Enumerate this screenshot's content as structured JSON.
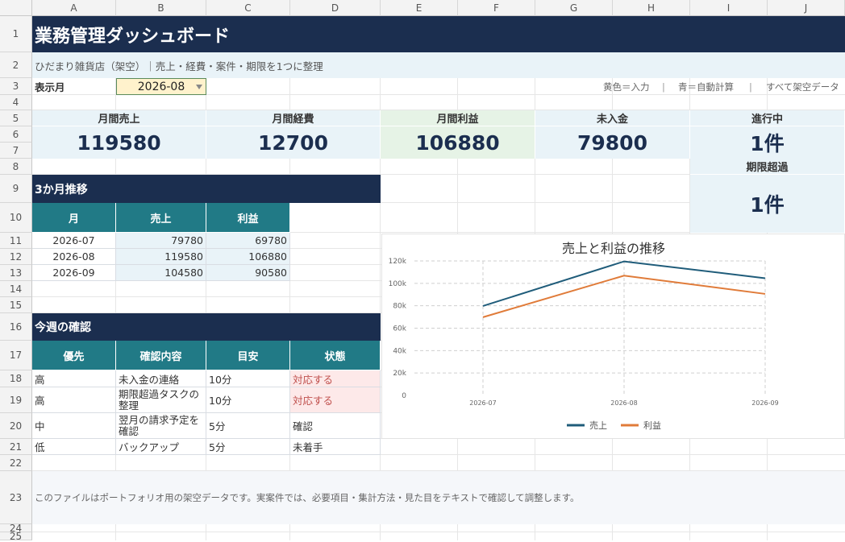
{
  "columns": [
    "A",
    "B",
    "C",
    "D",
    "E",
    "F",
    "G",
    "H",
    "I",
    "J"
  ],
  "rows": [
    "1",
    "2",
    "3",
    "4",
    "5",
    "6",
    "7",
    "8",
    "9",
    "10",
    "11",
    "12",
    "13",
    "14",
    "15",
    "16",
    "17",
    "18",
    "19",
    "20",
    "21",
    "22",
    "23",
    "24",
    "25"
  ],
  "header": {
    "title": "業務管理ダッシュボード",
    "subtitle": "ひだまり雑貨店（架空）｜売上・経費・案件・期限を1つに整理",
    "month_label": "表示月",
    "month_value": "2026-08",
    "legend_input": "黄色＝入力",
    "legend_sep1": "|",
    "legend_auto": "青＝自動計算",
    "legend_sep2": "|",
    "legend_fake": "すべて架空データ"
  },
  "kpis": {
    "sales": {
      "label": "月間売上",
      "value": "119580"
    },
    "expense": {
      "label": "月間経費",
      "value": "12700"
    },
    "profit": {
      "label": "月間利益",
      "value": "106880"
    },
    "unpaid": {
      "label": "未入金",
      "value": "79800"
    },
    "in_progress": {
      "label": "進行中",
      "value": "1件"
    },
    "overdue": {
      "label": "期限超過",
      "value": "1件"
    }
  },
  "trend": {
    "section_title": "3か月推移",
    "headers": [
      "月",
      "売上",
      "利益"
    ],
    "rows": [
      {
        "month": "2026-07",
        "sales": "79780",
        "profit": "69780"
      },
      {
        "month": "2026-08",
        "sales": "119580",
        "profit": "106880"
      },
      {
        "month": "2026-09",
        "sales": "104580",
        "profit": "90580"
      }
    ]
  },
  "weekly": {
    "section_title": "今週の確認",
    "headers": [
      "優先",
      "確認内容",
      "目安",
      "状態"
    ],
    "rows": [
      {
        "priority": "高",
        "task": "未入金の連絡",
        "time": "10分",
        "status": "対応する"
      },
      {
        "priority": "高",
        "task": "期限超過タスクの整理",
        "time": "10分",
        "status": "対応する"
      },
      {
        "priority": "中",
        "task": "翌月の請求予定を確認",
        "time": "5分",
        "status": "確認"
      },
      {
        "priority": "低",
        "task": "バックアップ",
        "time": "5分",
        "status": "未着手"
      }
    ]
  },
  "footer_note": "このファイルはポートフォリオ用の架空データです。実案件では、必要項目・集計方法・見た目をテキストで確認して調整します。",
  "chart_data": {
    "type": "line",
    "title": "売上と利益の推移",
    "categories": [
      "2026-07",
      "2026-08",
      "2026-09"
    ],
    "series": [
      {
        "name": "売上",
        "values": [
          79780,
          119580,
          104580
        ],
        "color": "#1f5c7a"
      },
      {
        "name": "利益",
        "values": [
          69780,
          106880,
          90580
        ],
        "color": "#e07b39"
      }
    ],
    "ylim": [
      0,
      120000
    ],
    "yticks": [
      "0",
      "20k",
      "40k",
      "60k",
      "80k",
      "100k",
      "120k"
    ],
    "grid": true,
    "legend": "bottom"
  }
}
